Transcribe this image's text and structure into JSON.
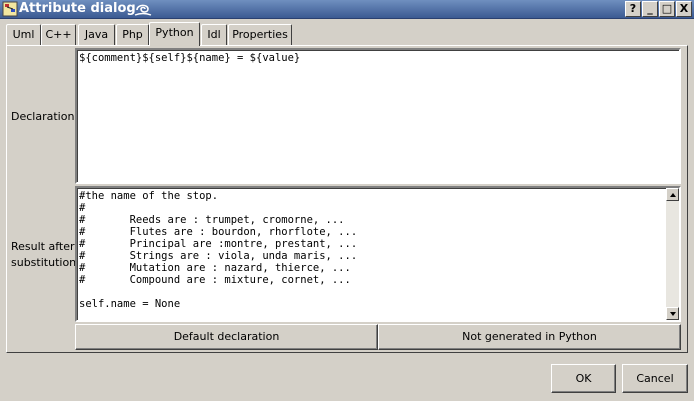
{
  "window": {
    "title": "Attribute dialog",
    "controls": [
      "?",
      "_",
      "□",
      "X"
    ]
  },
  "tabs": [
    {
      "label": "Uml"
    },
    {
      "label": "C++"
    },
    {
      "label": "Java"
    },
    {
      "label": "Php"
    },
    {
      "label": "Python",
      "active": true
    },
    {
      "label": "Idl"
    },
    {
      "label": "Properties"
    }
  ],
  "declaration": {
    "label": "Declaration :",
    "value": "${comment}${self}${name} = ${value}"
  },
  "result": {
    "label_line1": "Result after",
    "label_line2": "substitution :",
    "value": "#the name of the stop.\n#\n#       Reeds are : trumpet, cromorne, ...\n#       Flutes are : bourdon, rhorflote, ...\n#       Principal are :montre, prestant, ...\n#       Strings are : viola, unda maris, ...\n#       Mutation are : nazard, thierce, ...\n#       Compound are : mixture, cornet, ...\n\nself.name = None"
  },
  "buttons": {
    "default_declaration": "Default declaration",
    "not_generated": "Not generated in Python",
    "ok": "OK",
    "cancel": "Cancel"
  }
}
